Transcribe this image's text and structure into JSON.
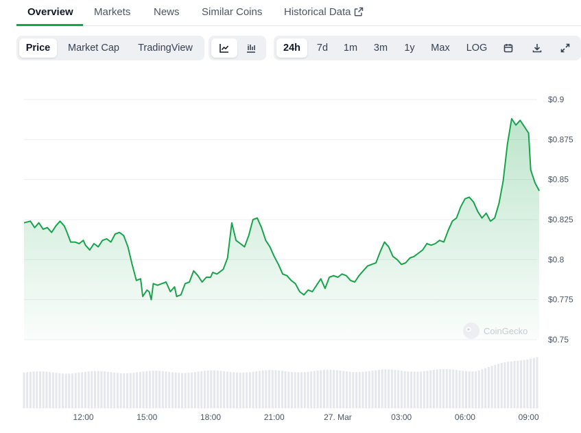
{
  "tabs": {
    "overview": "Overview",
    "markets": "Markets",
    "news": "News",
    "similar": "Similar Coins",
    "historical": "Historical Data"
  },
  "toolbar": {
    "price": "Price",
    "market_cap": "Market Cap",
    "tradingview": "TradingView",
    "range_24h": "24h",
    "range_7d": "7d",
    "range_1m": "1m",
    "range_3m": "3m",
    "range_1y": "1y",
    "range_max": "Max",
    "log": "LOG"
  },
  "watermark": "CoinGecko",
  "colors": {
    "line": "#16a34a",
    "accent": "#16a34a",
    "volume": "#e5e7eb",
    "grid": "#eceef1"
  },
  "icons": {
    "line_chart": "line-chart-icon",
    "candle_chart": "candlestick-chart-icon",
    "calendar": "calendar-icon",
    "download": "download-icon",
    "fullscreen": "expand-icon",
    "external": "external-link-icon"
  },
  "chart_data": {
    "type": "area",
    "title": "",
    "xlabel": "",
    "ylabel": "",
    "ylim": [
      0.75,
      0.9
    ],
    "yticks": [
      "$0.9",
      "$0.875",
      "$0.85",
      "$0.825",
      "$0.8",
      "$0.775",
      "$0.75"
    ],
    "ytick_values": [
      0.9,
      0.875,
      0.85,
      0.825,
      0.8,
      0.775,
      0.75
    ],
    "x_unit": "hour",
    "xlim": [
      9.2,
      33.4
    ],
    "xticks": [
      {
        "label": "12:00",
        "x": 12
      },
      {
        "label": "15:00",
        "x": 15
      },
      {
        "label": "18:00",
        "x": 18
      },
      {
        "label": "21:00",
        "x": 21
      },
      {
        "label": "27. Mar",
        "x": 24
      },
      {
        "label": "03:00",
        "x": 27
      },
      {
        "label": "06:00",
        "x": 30
      },
      {
        "label": "09:00",
        "x": 33
      }
    ],
    "grid": true,
    "series": [
      {
        "values": [
          [
            9.2,
            0.823
          ],
          [
            9.5,
            0.824
          ],
          [
            9.7,
            0.82
          ],
          [
            9.9,
            0.823
          ],
          [
            10.1,
            0.819
          ],
          [
            10.3,
            0.82
          ],
          [
            10.5,
            0.817
          ],
          [
            10.7,
            0.821
          ],
          [
            10.9,
            0.824
          ],
          [
            11.1,
            0.821
          ],
          [
            11.2,
            0.818
          ],
          [
            11.4,
            0.811
          ],
          [
            11.6,
            0.811
          ],
          [
            11.8,
            0.81
          ],
          [
            12.0,
            0.812
          ],
          [
            12.1,
            0.809
          ],
          [
            12.3,
            0.806
          ],
          [
            12.5,
            0.81
          ],
          [
            12.7,
            0.808
          ],
          [
            12.9,
            0.812
          ],
          [
            13.1,
            0.813
          ],
          [
            13.3,
            0.811
          ],
          [
            13.5,
            0.816
          ],
          [
            13.7,
            0.817
          ],
          [
            13.9,
            0.815
          ],
          [
            14.1,
            0.808
          ],
          [
            14.3,
            0.797
          ],
          [
            14.5,
            0.787
          ],
          [
            14.7,
            0.788
          ],
          [
            14.8,
            0.777
          ],
          [
            15.0,
            0.781
          ],
          [
            15.1,
            0.78
          ],
          [
            15.2,
            0.775
          ],
          [
            15.3,
            0.785
          ],
          [
            15.5,
            0.784
          ],
          [
            15.7,
            0.785
          ],
          [
            15.9,
            0.786
          ],
          [
            16.1,
            0.78
          ],
          [
            16.3,
            0.783
          ],
          [
            16.4,
            0.777
          ],
          [
            16.6,
            0.778
          ],
          [
            16.8,
            0.785
          ],
          [
            17.0,
            0.786
          ],
          [
            17.2,
            0.793
          ],
          [
            17.4,
            0.79
          ],
          [
            17.6,
            0.786
          ],
          [
            17.8,
            0.789
          ],
          [
            18.0,
            0.789
          ],
          [
            18.1,
            0.792
          ],
          [
            18.3,
            0.791
          ],
          [
            18.5,
            0.793
          ],
          [
            18.6,
            0.794
          ],
          [
            18.8,
            0.801
          ],
          [
            19.0,
            0.823
          ],
          [
            19.2,
            0.812
          ],
          [
            19.4,
            0.81
          ],
          [
            19.6,
            0.808
          ],
          [
            19.8,
            0.815
          ],
          [
            20.0,
            0.825
          ],
          [
            20.2,
            0.826
          ],
          [
            20.4,
            0.82
          ],
          [
            20.6,
            0.812
          ],
          [
            20.8,
            0.808
          ],
          [
            21.0,
            0.802
          ],
          [
            21.2,
            0.797
          ],
          [
            21.4,
            0.791
          ],
          [
            21.6,
            0.79
          ],
          [
            21.8,
            0.787
          ],
          [
            22.0,
            0.785
          ],
          [
            22.2,
            0.78
          ],
          [
            22.4,
            0.778
          ],
          [
            22.6,
            0.781
          ],
          [
            22.8,
            0.78
          ],
          [
            23.0,
            0.784
          ],
          [
            23.2,
            0.788
          ],
          [
            23.4,
            0.782
          ],
          [
            23.6,
            0.789
          ],
          [
            23.8,
            0.79
          ],
          [
            24.0,
            0.789
          ],
          [
            24.2,
            0.791
          ],
          [
            24.4,
            0.79
          ],
          [
            24.6,
            0.787
          ],
          [
            24.8,
            0.786
          ],
          [
            25.0,
            0.79
          ],
          [
            25.2,
            0.793
          ],
          [
            25.4,
            0.796
          ],
          [
            25.6,
            0.797
          ],
          [
            25.8,
            0.798
          ],
          [
            26.0,
            0.805
          ],
          [
            26.2,
            0.811
          ],
          [
            26.4,
            0.808
          ],
          [
            26.6,
            0.802
          ],
          [
            26.8,
            0.8
          ],
          [
            27.0,
            0.797
          ],
          [
            27.2,
            0.798
          ],
          [
            27.4,
            0.801
          ],
          [
            27.6,
            0.802
          ],
          [
            27.8,
            0.804
          ],
          [
            28.0,
            0.806
          ],
          [
            28.2,
            0.81
          ],
          [
            28.4,
            0.809
          ],
          [
            28.6,
            0.81
          ],
          [
            28.8,
            0.812
          ],
          [
            29.0,
            0.811
          ],
          [
            29.2,
            0.818
          ],
          [
            29.4,
            0.824
          ],
          [
            29.6,
            0.826
          ],
          [
            29.8,
            0.833
          ],
          [
            30.0,
            0.838
          ],
          [
            30.2,
            0.839
          ],
          [
            30.4,
            0.836
          ],
          [
            30.6,
            0.83
          ],
          [
            30.8,
            0.826
          ],
          [
            31.0,
            0.829
          ],
          [
            31.2,
            0.824
          ],
          [
            31.4,
            0.826
          ],
          [
            31.6,
            0.835
          ],
          [
            31.8,
            0.849
          ],
          [
            32.0,
            0.872
          ],
          [
            32.2,
            0.888
          ],
          [
            32.4,
            0.884
          ],
          [
            32.6,
            0.887
          ],
          [
            32.8,
            0.883
          ],
          [
            33.0,
            0.879
          ],
          [
            33.1,
            0.856
          ],
          [
            33.3,
            0.848
          ],
          [
            33.5,
            0.843
          ]
        ]
      }
    ]
  }
}
